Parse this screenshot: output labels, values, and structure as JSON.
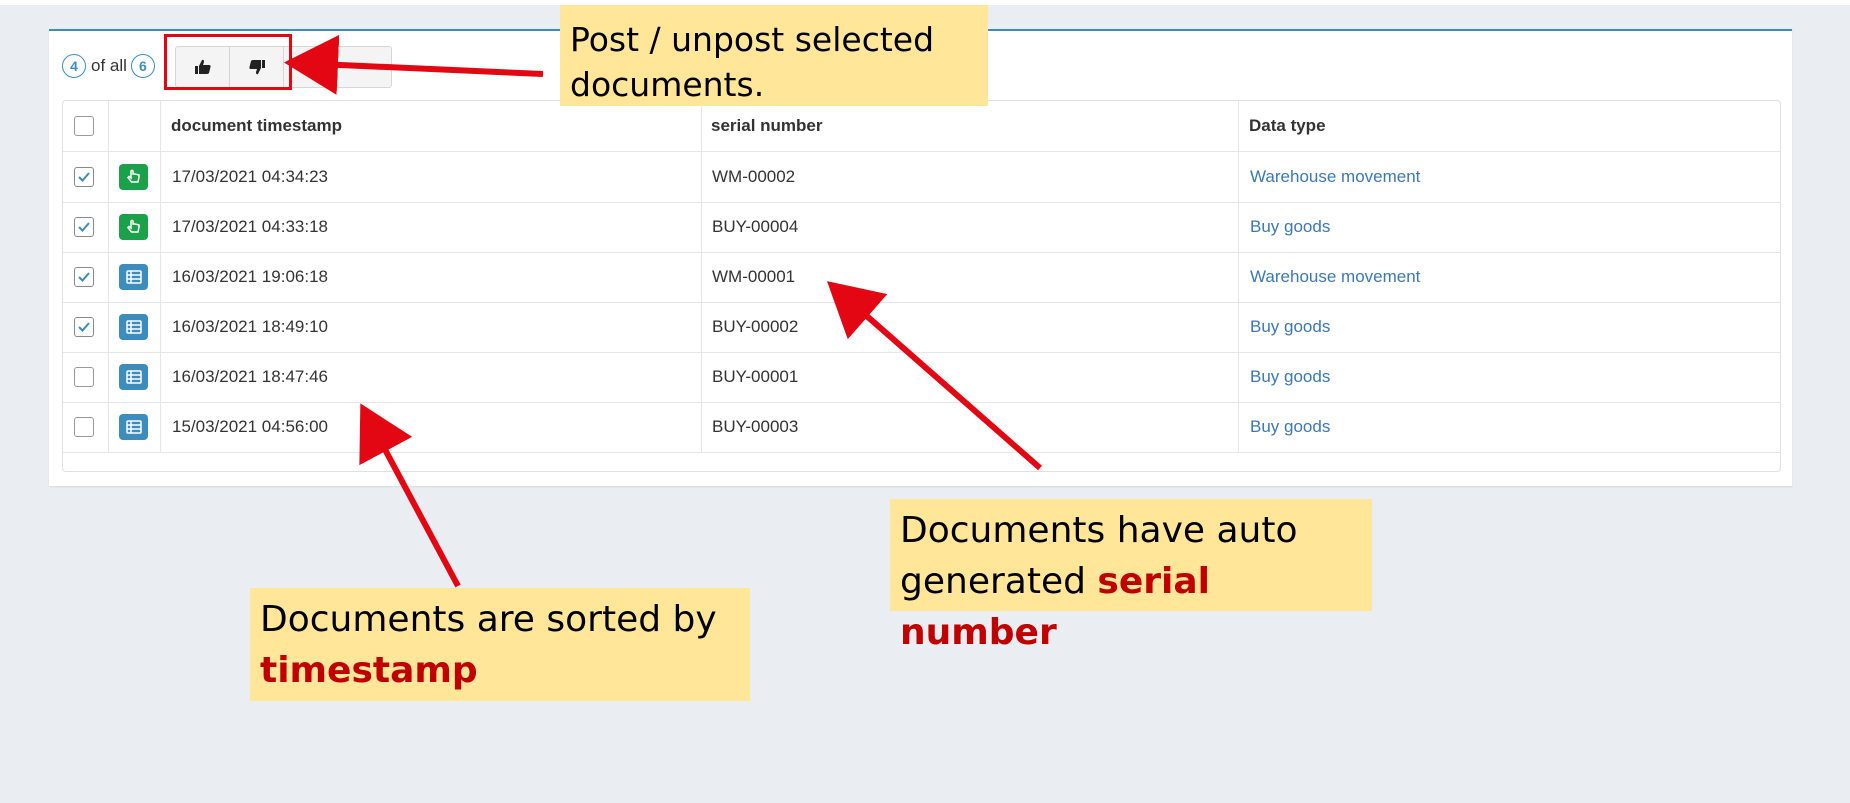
{
  "toolbar": {
    "selected_count": "4",
    "of_all_label": "of all",
    "total_count": "6",
    "buttons": [
      {
        "icon": "thumbs-up-icon"
      },
      {
        "icon": "thumbs-down-icon"
      },
      {
        "icon": "menu-icon"
      },
      {
        "icon": "more-icon"
      }
    ]
  },
  "table": {
    "headers": {
      "timestamp": "document timestamp",
      "serial": "serial number",
      "type": "Data type"
    },
    "rows": [
      {
        "checked": true,
        "status": "posted",
        "timestamp": "17/03/2021 04:34:23",
        "serial": "WM-00002",
        "type": "Warehouse movement"
      },
      {
        "checked": true,
        "status": "posted",
        "timestamp": "17/03/2021 04:33:18",
        "serial": "BUY-00004",
        "type": "Buy goods"
      },
      {
        "checked": true,
        "status": "unposted",
        "timestamp": "16/03/2021 19:06:18",
        "serial": "WM-00001",
        "type": "Warehouse movement"
      },
      {
        "checked": true,
        "status": "unposted",
        "timestamp": "16/03/2021 18:49:10",
        "serial": "BUY-00002",
        "type": "Buy goods"
      },
      {
        "checked": false,
        "status": "unposted",
        "timestamp": "16/03/2021 18:47:46",
        "serial": "BUY-00001",
        "type": "Buy goods"
      },
      {
        "checked": false,
        "status": "unposted",
        "timestamp": "15/03/2021 04:56:00",
        "serial": "BUY-00003",
        "type": "Buy goods"
      }
    ]
  },
  "callouts": {
    "post": {
      "line1": "Post / unpost selected",
      "line2": "documents."
    },
    "serial": {
      "line1": "Documents have auto",
      "line2_prefix": "generated ",
      "line2_highlight": "serial number"
    },
    "sorted": {
      "line1": "Documents are sorted by",
      "line2_highlight": "timestamp"
    }
  },
  "colors": {
    "posted_icon": "#1aa14a",
    "unposted_icon": "#3c8dbc",
    "link": "#3c78b4",
    "accent": "#3c8dbc",
    "annotation_red": "#e30613",
    "callout_bg": "#ffe699",
    "highlight_text": "#c00000"
  }
}
